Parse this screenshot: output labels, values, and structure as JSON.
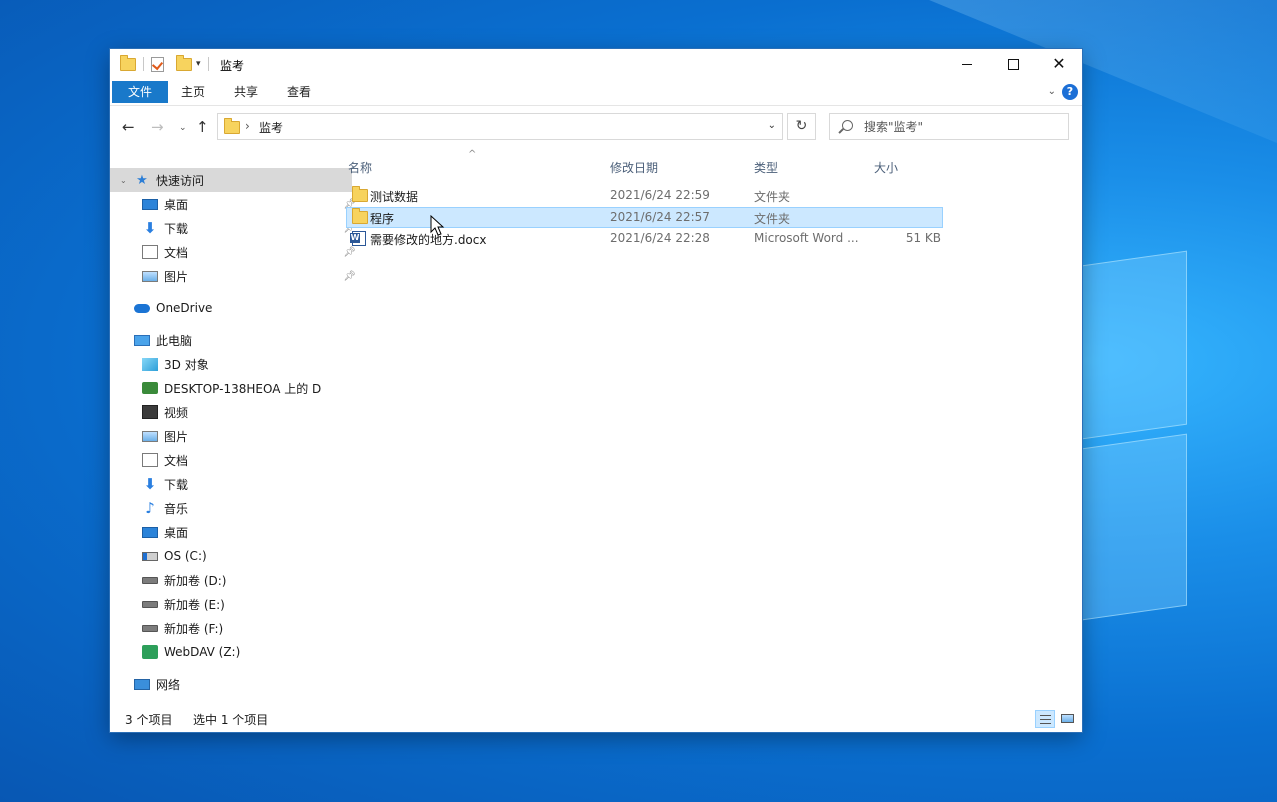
{
  "window": {
    "title": "监考",
    "controls": {
      "minimize": "minimize",
      "maximize": "maximize",
      "close": "close"
    }
  },
  "ribbon": {
    "tabs": [
      {
        "label": "文件",
        "active": true
      },
      {
        "label": "主页"
      },
      {
        "label": "共享"
      },
      {
        "label": "查看"
      }
    ],
    "help_label": "?"
  },
  "address": {
    "path_label": "监考",
    "separator": "›",
    "refresh_glyph": "↻"
  },
  "search": {
    "placeholder": "搜索\"监考\""
  },
  "nav": {
    "quick_access": "快速访问",
    "pinned": [
      {
        "label": "桌面",
        "icon": "desktop-icon"
      },
      {
        "label": "下载",
        "icon": "download-icon"
      },
      {
        "label": "文档",
        "icon": "document-icon"
      },
      {
        "label": "图片",
        "icon": "picture-icon"
      }
    ],
    "onedrive": "OneDrive",
    "this_pc": "此电脑",
    "pc_items": [
      {
        "label": "3D 对象"
      },
      {
        "label": "DESKTOP-138HEOA 上的 D"
      },
      {
        "label": "视频"
      },
      {
        "label": "图片"
      },
      {
        "label": "文档"
      },
      {
        "label": "下载"
      },
      {
        "label": "音乐"
      },
      {
        "label": "桌面"
      },
      {
        "label": "OS (C:)"
      },
      {
        "label": "新加卷 (D:)"
      },
      {
        "label": "新加卷 (E:)"
      },
      {
        "label": "新加卷 (F:)"
      },
      {
        "label": "WebDAV (Z:)"
      }
    ],
    "network": "网络"
  },
  "columns": {
    "name": "名称",
    "date": "修改日期",
    "type": "类型",
    "size": "大小"
  },
  "files": [
    {
      "name": "测试数据",
      "date": "2021/6/24 22:59",
      "type": "文件夹",
      "size": "",
      "selected": false
    },
    {
      "name": "程序",
      "date": "2021/6/24 22:57",
      "type": "文件夹",
      "size": "",
      "selected": true
    },
    {
      "name": "需要修改的地方.docx",
      "date": "2021/6/24 22:28",
      "type": "Microsoft Word ...",
      "size": "51 KB",
      "selected": false
    }
  ],
  "status": {
    "count": "3 个项目",
    "selection": "选中 1 个项目"
  },
  "colors": {
    "accent": "#1979ca",
    "selection_bg": "#cce8ff",
    "selection_border": "#99d1ff"
  }
}
